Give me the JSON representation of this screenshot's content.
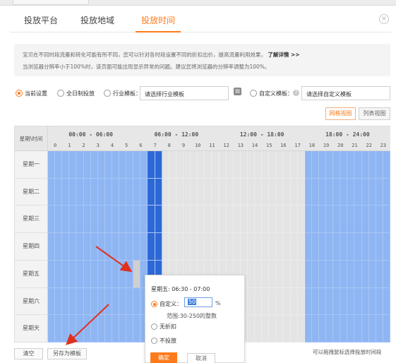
{
  "tabs": [
    {
      "label": "投放平台",
      "active": false
    },
    {
      "label": "投放地域",
      "active": false
    },
    {
      "label": "投放时间",
      "active": true
    }
  ],
  "close_icon": "circle-x-icon",
  "notice": {
    "line1": "宝贝在不同时段流量和转化可能有所不同，您可以针对各时段设置不同的折扣出价，提高流量利用效果，",
    "link": "了解详情 >>",
    "line2": "当浏览器分辨率小于100%时，该页面可能出现显示异常的问题。建议您将浏览器的分辨率调整为100%。"
  },
  "options": {
    "current": "当前设置",
    "all_day": "全日制投放",
    "industry": "行业模板：",
    "industry_select": "请选择行业模板",
    "custom": "自定义模板：",
    "custom_select": "请选择自定义模板",
    "selected": "current"
  },
  "views": {
    "grid": "网格视图",
    "list": "列表视图",
    "active": "grid"
  },
  "grid": {
    "corner": "星期\\时间",
    "ranges": [
      "00:00 - 06:00",
      "06:00 - 12:00",
      "12:00 - 18:00",
      "18:00 - 24:00"
    ],
    "hours": [
      "0",
      "1",
      "2",
      "3",
      "4",
      "5",
      "6",
      "7",
      "8",
      "9",
      "10",
      "11",
      "12",
      "13",
      "14",
      "15",
      "16",
      "17",
      "18",
      "19",
      "20",
      "21",
      "22",
      "23"
    ],
    "days": [
      "星期一",
      "星期二",
      "星期三",
      "星期四",
      "星期五",
      "星期六",
      "星期天"
    ],
    "fill_rows_levels": {
      "note": "per-day fill per half-hour slot: 1 = discounted, 2 = highlighted, 0 = not set, 3 = hovered",
      "default_day": "1x14,2x2,0x20,1x12",
      "friday": "1x12,3x1,1x1,2x2,0x20,1x12"
    }
  },
  "buttons": {
    "clear": "清空",
    "save_template": "另存为模板"
  },
  "hint": "可以拖拽鼠标选择投放时间段",
  "popup": {
    "title": "星期五:   06:30 - 07:00",
    "custom_label": "自定义：",
    "value": "50",
    "unit": "%",
    "range_tip": "范围:30-250的整数",
    "no_discount": "无折扣",
    "no_delivery": "不投放",
    "ok": "确定",
    "cancel": "取消"
  },
  "colors": {
    "accent": "#ff7a1a",
    "cell_discount": "#8fb6f3",
    "cell_strong": "#2e68d6",
    "cell_empty": "#e4e4e4",
    "cell_hover": "#d0d0d0",
    "arrow": "#e0301e"
  }
}
